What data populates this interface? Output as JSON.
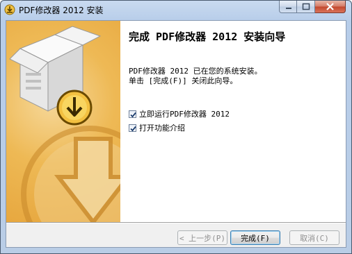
{
  "window": {
    "title": "PDF修改器 2012 安装",
    "accent": "#e6a53c"
  },
  "icons": {
    "title": "installer-icon",
    "banner": "box-download-icon",
    "minimize": "minimize-icon",
    "maximize": "maximize-icon",
    "close": "close-icon",
    "check": "checkmark-icon"
  },
  "main": {
    "heading": "完成 PDF修改器 2012 安装向导",
    "desc_line1": "PDF修改器 2012 已在您的系统安装。",
    "desc_line2": "单击 [完成(F)] 关闭此向导。",
    "options": [
      {
        "label": "立即运行PDF修改器 2012",
        "checked": true
      },
      {
        "label": "打开功能介绍",
        "checked": true
      }
    ]
  },
  "buttons": {
    "back": "< 上一步(P)",
    "finish": "完成(F)",
    "cancel": "取消(C)"
  }
}
